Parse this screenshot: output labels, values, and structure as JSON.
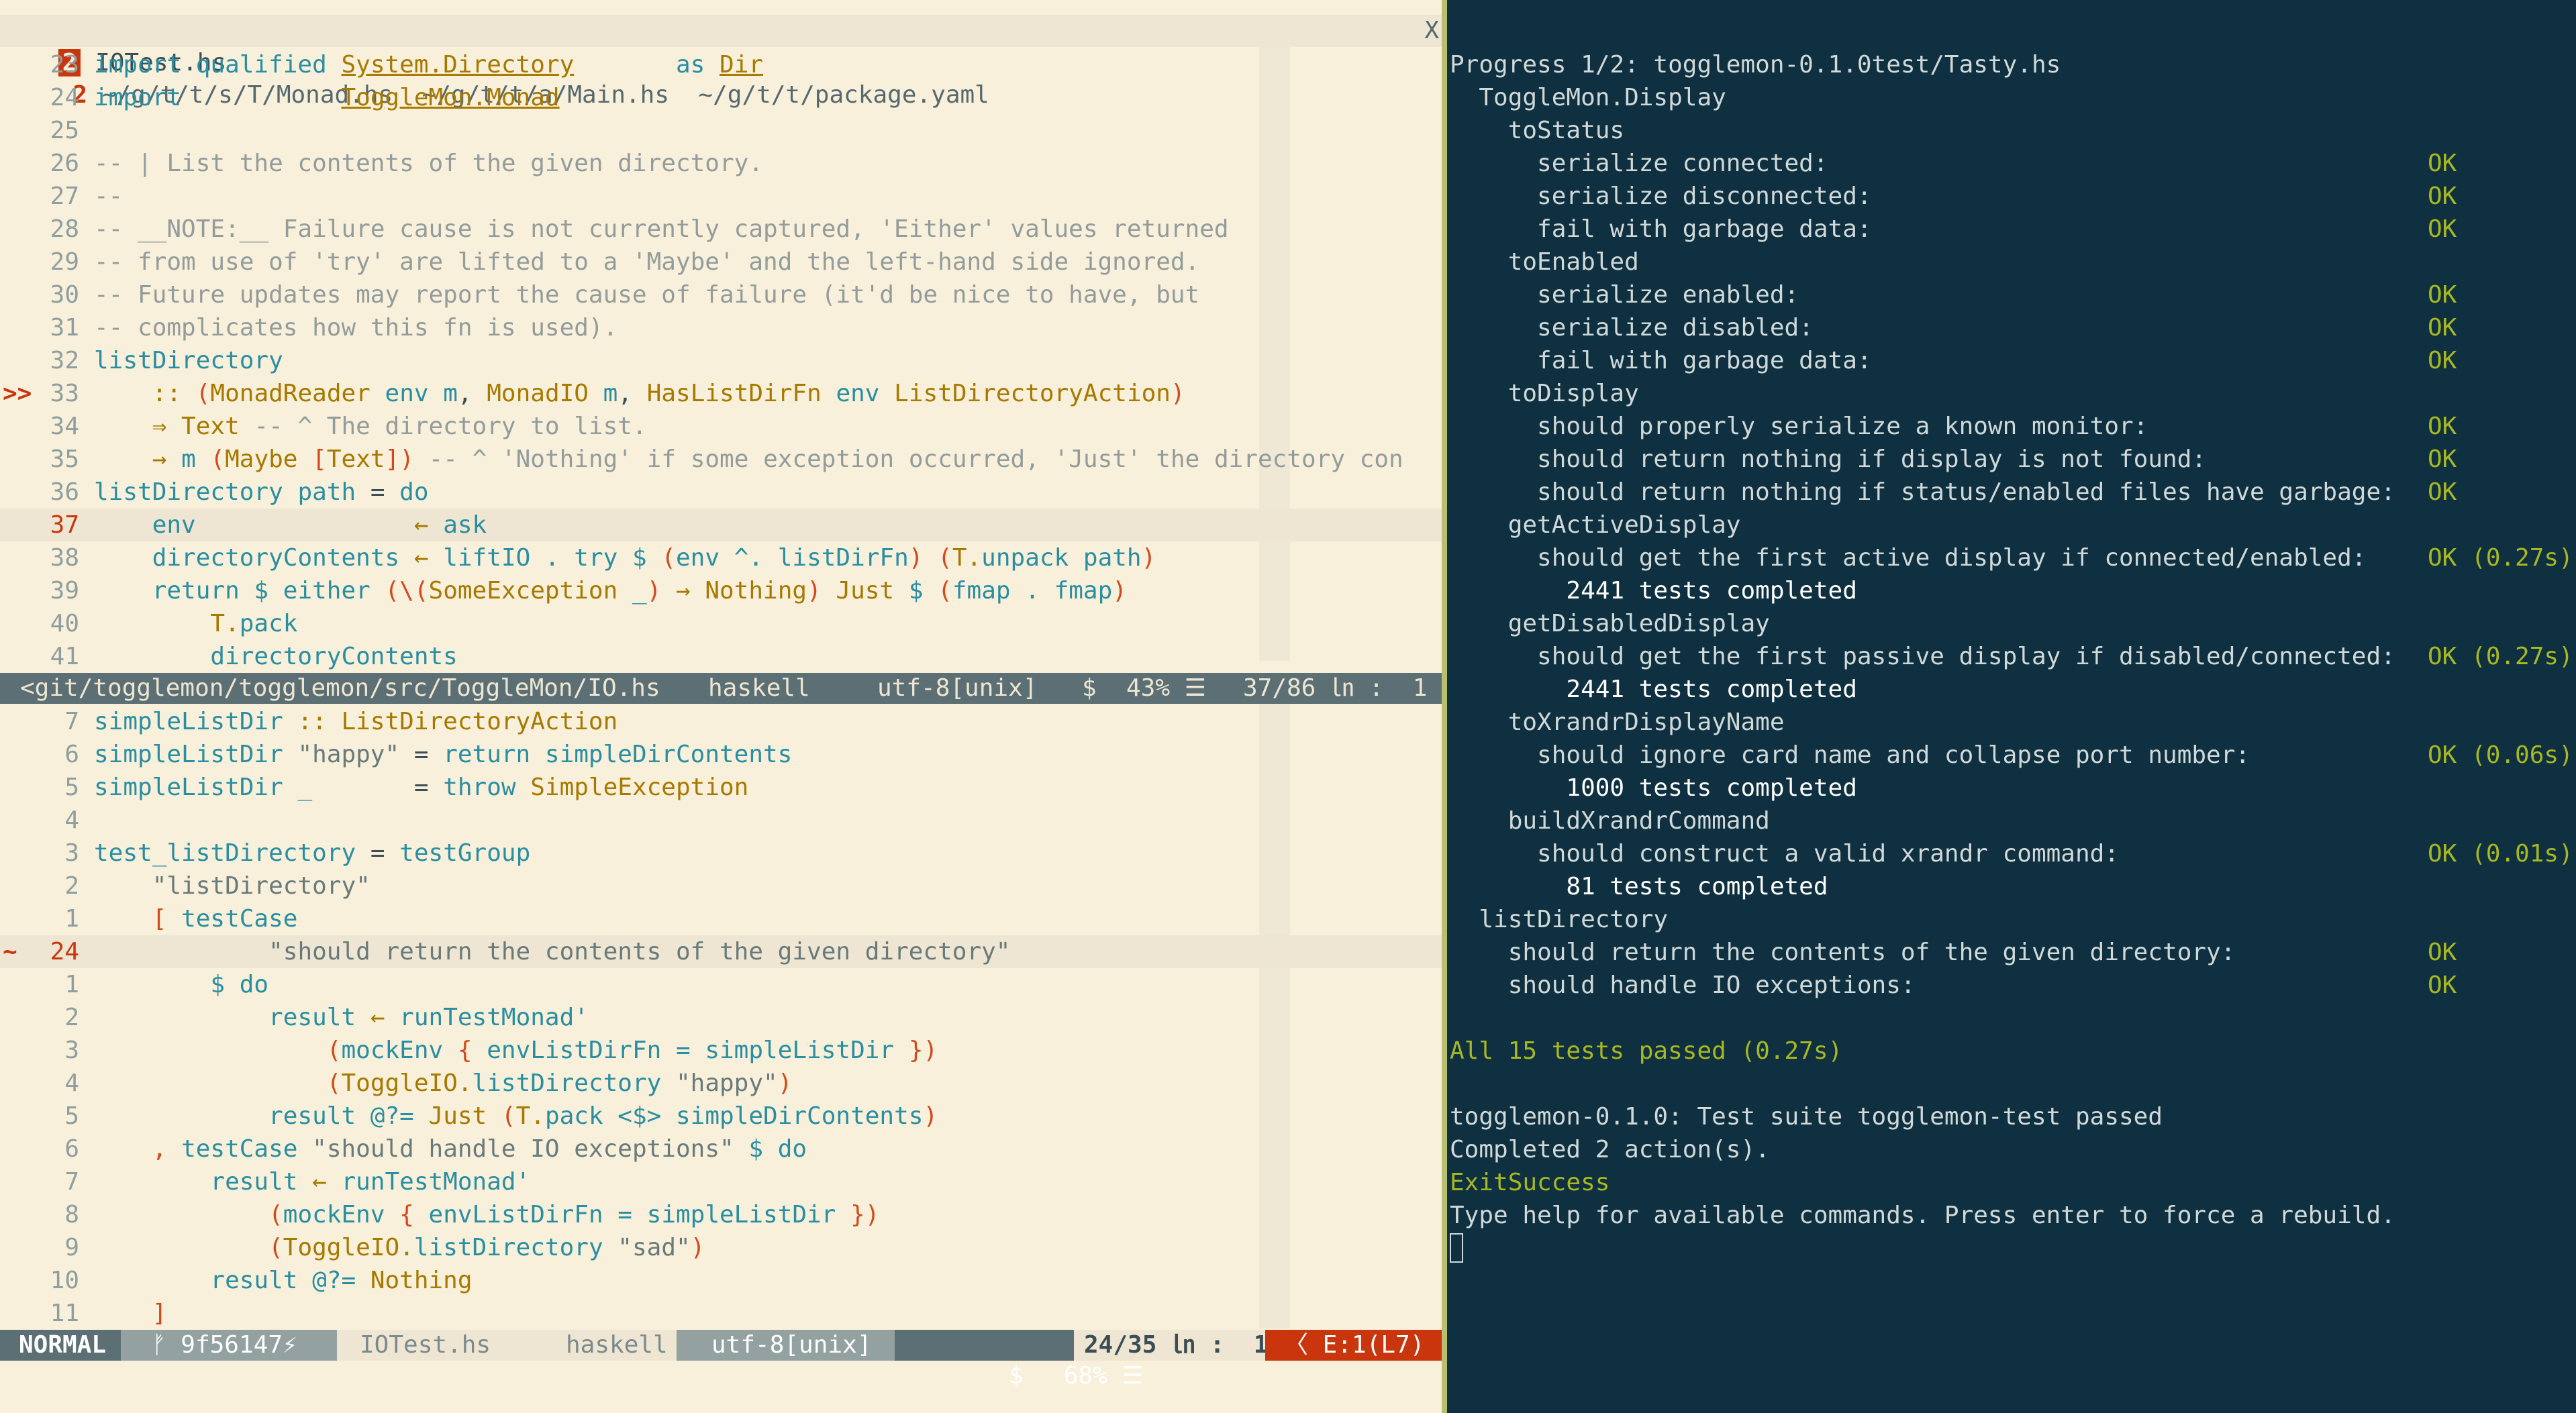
{
  "tabline": {
    "tab1_num": "2",
    "tab1_label": "IOTest.hs",
    "tab2_num": "2",
    "tab2_label": " ~/g/t/t/s/T/Monad.hs  ~/g/t/t/a/Main.hs  ~/g/t/t/package.yaml",
    "close": "X"
  },
  "top_pane": {
    "lines": [
      {
        "n": "23",
        "parts": [
          [
            "kw",
            "import qualified "
          ],
          [
            "ty ul",
            "System.Directory"
          ],
          [
            "plain",
            "       "
          ],
          [
            "kw",
            "as "
          ],
          [
            "ty ul",
            "Dir"
          ]
        ]
      },
      {
        "n": "24",
        "parts": [
          [
            "kw",
            "import           "
          ],
          [
            "ty ul",
            "ToggleMon.Monad"
          ]
        ]
      },
      {
        "n": "25",
        "parts": []
      },
      {
        "n": "26",
        "parts": [
          [
            "cm",
            "-- | List the contents of the given directory."
          ]
        ]
      },
      {
        "n": "27",
        "parts": [
          [
            "cm",
            "--"
          ]
        ]
      },
      {
        "n": "28",
        "parts": [
          [
            "cm",
            "-- __NOTE:__ Failure cause is not currently captured, 'Either' values returned"
          ]
        ]
      },
      {
        "n": "29",
        "parts": [
          [
            "cm",
            "-- from use of 'try' are lifted to a 'Maybe' and the left-hand side ignored."
          ]
        ]
      },
      {
        "n": "30",
        "parts": [
          [
            "cm",
            "-- Future updates may report the cause of failure (it'd be nice to have, but"
          ]
        ]
      },
      {
        "n": "31",
        "parts": [
          [
            "cm",
            "-- complicates how this fn is used)."
          ]
        ]
      },
      {
        "n": "32",
        "parts": [
          [
            "fn",
            "listDirectory"
          ]
        ]
      },
      {
        "n": "33",
        "sign": ">>",
        "parts": [
          [
            "plain",
            "    "
          ],
          [
            "ty",
            ":: "
          ],
          [
            "op",
            "("
          ],
          [
            "ty",
            "MonadReader "
          ],
          [
            "pl",
            "env m"
          ],
          [
            "plain",
            ", "
          ],
          [
            "ty",
            "MonadIO "
          ],
          [
            "pl",
            "m"
          ],
          [
            "plain",
            ", "
          ],
          [
            "ty",
            "HasListDirFn "
          ],
          [
            "pl",
            "env "
          ],
          [
            "ty",
            "ListDirectoryAction"
          ],
          [
            "op",
            ")"
          ]
        ]
      },
      {
        "n": "34",
        "parts": [
          [
            "plain",
            "    "
          ],
          [
            "ty",
            "⇒ Text "
          ],
          [
            "cm",
            "-- ^ The directory to list."
          ]
        ]
      },
      {
        "n": "35",
        "parts": [
          [
            "plain",
            "    "
          ],
          [
            "ty",
            "→ "
          ],
          [
            "pl",
            "m "
          ],
          [
            "op",
            "("
          ],
          [
            "ty",
            "Maybe "
          ],
          [
            "op",
            "["
          ],
          [
            "ty",
            "Text"
          ],
          [
            "op",
            "]) "
          ],
          [
            "cm",
            "-- ^ 'Nothing' if some exception occurred, 'Just' the directory con"
          ]
        ]
      },
      {
        "n": "36",
        "parts": [
          [
            "fn",
            "listDirectory "
          ],
          [
            "pl",
            "path "
          ],
          [
            "plain",
            "= "
          ],
          [
            "kw",
            "do"
          ]
        ]
      },
      {
        "n": "37",
        "cur": true,
        "parts": [
          [
            "plain",
            "    "
          ],
          [
            "pl",
            "env"
          ],
          [
            "plain",
            "               "
          ],
          [
            "ty",
            "← "
          ],
          [
            "pl",
            "ask"
          ]
        ]
      },
      {
        "n": "38",
        "parts": [
          [
            "plain",
            "    "
          ],
          [
            "pl",
            "directoryContents "
          ],
          [
            "ty",
            "← "
          ],
          [
            "pl",
            "liftIO . try $ "
          ],
          [
            "op",
            "("
          ],
          [
            "pl",
            "env ^. listDirFn"
          ],
          [
            "op",
            ") ("
          ],
          [
            "ty",
            "T."
          ],
          [
            "pl",
            "unpack path"
          ],
          [
            "op",
            ")"
          ]
        ]
      },
      {
        "n": "39",
        "parts": [
          [
            "plain",
            "    "
          ],
          [
            "pl",
            "return $ either "
          ],
          [
            "op",
            "(\\("
          ],
          [
            "ty",
            "SomeException "
          ],
          [
            "pl",
            "_"
          ],
          [
            "op",
            ") "
          ],
          [
            "ty",
            "→ Nothing"
          ],
          [
            "op",
            ") "
          ],
          [
            "ty",
            "Just "
          ],
          [
            "pl",
            "$ "
          ],
          [
            "op",
            "("
          ],
          [
            "pl",
            "fmap . fmap"
          ],
          [
            "op",
            ")"
          ]
        ]
      },
      {
        "n": "40",
        "parts": [
          [
            "plain",
            "        "
          ],
          [
            "ty",
            "T."
          ],
          [
            "pl",
            "pack"
          ]
        ]
      },
      {
        "n": "41",
        "parts": [
          [
            "plain",
            "        "
          ],
          [
            "pl",
            "directoryContents"
          ]
        ]
      }
    ]
  },
  "status1": {
    "path": "<git/togglemon/togglemon/src/ToggleMon/IO.hs",
    "filetype": "haskell",
    "encoding": "utf-8[unix]",
    "dollar": "$",
    "percent": "43% ☰",
    "position": "37/86 ㏑ :  1"
  },
  "bottom_pane": {
    "lines": [
      {
        "n": "7",
        "parts": [
          [
            "fn",
            "simpleListDir "
          ],
          [
            "ty",
            ":: ListDirectoryAction"
          ]
        ]
      },
      {
        "n": "6",
        "parts": [
          [
            "fn",
            "simpleListDir "
          ],
          [
            "st",
            "\"happy\" "
          ],
          [
            "plain",
            "= "
          ],
          [
            "pl",
            "return simpleDirContents"
          ]
        ]
      },
      {
        "n": "5",
        "parts": [
          [
            "fn",
            "simpleListDir "
          ],
          [
            "pl",
            "_       "
          ],
          [
            "plain",
            "= "
          ],
          [
            "pl",
            "throw "
          ],
          [
            "ty",
            "SimpleException"
          ]
        ]
      },
      {
        "n": "4",
        "parts": []
      },
      {
        "n": "3",
        "parts": [
          [
            "fn",
            "test_listDirectory "
          ],
          [
            "plain",
            "= "
          ],
          [
            "pl",
            "testGroup"
          ]
        ]
      },
      {
        "n": "2",
        "parts": [
          [
            "plain",
            "    "
          ],
          [
            "st",
            "\"listDirectory\""
          ]
        ]
      },
      {
        "n": "1",
        "parts": [
          [
            "plain",
            "    "
          ],
          [
            "op",
            "[ "
          ],
          [
            "pl",
            "testCase"
          ]
        ]
      },
      {
        "n": "24",
        "sign": "~",
        "cur": true,
        "parts": [
          [
            "plain",
            "            "
          ],
          [
            "st",
            "\"should return the contents of the given directory\""
          ]
        ]
      },
      {
        "n": "1",
        "parts": [
          [
            "plain",
            "        "
          ],
          [
            "pl",
            "$ "
          ],
          [
            "kw",
            "do"
          ]
        ]
      },
      {
        "n": "2",
        "parts": [
          [
            "plain",
            "            "
          ],
          [
            "pl",
            "result "
          ],
          [
            "ty",
            "← "
          ],
          [
            "pl",
            "runTestMonad'"
          ]
        ]
      },
      {
        "n": "3",
        "parts": [
          [
            "plain",
            "                "
          ],
          [
            "op",
            "("
          ],
          [
            "pl",
            "mockEnv "
          ],
          [
            "op",
            "{ "
          ],
          [
            "pl",
            "envListDirFn = simpleListDir "
          ],
          [
            "op",
            "})"
          ]
        ]
      },
      {
        "n": "4",
        "parts": [
          [
            "plain",
            "                "
          ],
          [
            "op",
            "("
          ],
          [
            "ty",
            "ToggleIO."
          ],
          [
            "pl",
            "listDirectory "
          ],
          [
            "st",
            "\"happy\""
          ],
          [
            "op",
            ")"
          ]
        ]
      },
      {
        "n": "5",
        "parts": [
          [
            "plain",
            "            "
          ],
          [
            "pl",
            "result @?= "
          ],
          [
            "ty",
            "Just "
          ],
          [
            "op",
            "("
          ],
          [
            "ty",
            "T."
          ],
          [
            "pl",
            "pack <$> simpleDirContents"
          ],
          [
            "op",
            ")"
          ]
        ]
      },
      {
        "n": "6",
        "parts": [
          [
            "plain",
            "    "
          ],
          [
            "op",
            ", "
          ],
          [
            "pl",
            "testCase "
          ],
          [
            "st",
            "\"should handle IO exceptions\" "
          ],
          [
            "pl",
            "$ "
          ],
          [
            "kw",
            "do"
          ]
        ]
      },
      {
        "n": "7",
        "parts": [
          [
            "plain",
            "        "
          ],
          [
            "pl",
            "result "
          ],
          [
            "ty",
            "← "
          ],
          [
            "pl",
            "runTestMonad'"
          ]
        ]
      },
      {
        "n": "8",
        "parts": [
          [
            "plain",
            "            "
          ],
          [
            "op",
            "("
          ],
          [
            "pl",
            "mockEnv "
          ],
          [
            "op",
            "{ "
          ],
          [
            "pl",
            "envListDirFn = simpleListDir "
          ],
          [
            "op",
            "})"
          ]
        ]
      },
      {
        "n": "9",
        "parts": [
          [
            "plain",
            "            "
          ],
          [
            "op",
            "("
          ],
          [
            "ty",
            "ToggleIO."
          ],
          [
            "pl",
            "listDirectory "
          ],
          [
            "st",
            "\"sad\""
          ],
          [
            "op",
            ")"
          ]
        ]
      },
      {
        "n": "10",
        "parts": [
          [
            "plain",
            "        "
          ],
          [
            "pl",
            "result @?= "
          ],
          [
            "ty",
            "Nothing"
          ]
        ]
      },
      {
        "n": "11",
        "parts": [
          [
            "plain",
            "    "
          ],
          [
            "op",
            "]"
          ]
        ]
      }
    ]
  },
  "status2": {
    "mode": "NORMAL",
    "branch": "ᚠ 9f56147⚡",
    "file": "IOTest.hs",
    "filetype": "haskell",
    "encoding": "utf-8[unix]",
    "dollar": "$",
    "percent": "68% ☰",
    "position": "24/35 ㏑ :  1",
    "error": "〈 E:1(L7)"
  },
  "terminal": {
    "lines": [
      {
        "indent": "",
        "text": "Progress 1/2: togglemon-0.1.0test/Tasty.hs",
        "ok": ""
      },
      {
        "indent": "  ",
        "text": "ToggleMon.Display",
        "ok": ""
      },
      {
        "indent": "    ",
        "text": "toStatus",
        "ok": ""
      },
      {
        "indent": "      ",
        "text": "serialize connected:",
        "ok": "OK"
      },
      {
        "indent": "      ",
        "text": "serialize disconnected:",
        "ok": "OK"
      },
      {
        "indent": "      ",
        "text": "fail with garbage data:",
        "ok": "OK"
      },
      {
        "indent": "    ",
        "text": "toEnabled",
        "ok": ""
      },
      {
        "indent": "      ",
        "text": "serialize enabled:",
        "ok": "OK"
      },
      {
        "indent": "      ",
        "text": "serialize disabled:",
        "ok": "OK"
      },
      {
        "indent": "      ",
        "text": "fail with garbage data:",
        "ok": "OK"
      },
      {
        "indent": "    ",
        "text": "toDisplay",
        "ok": ""
      },
      {
        "indent": "      ",
        "text": "should properly serialize a known monitor:",
        "ok": "OK"
      },
      {
        "indent": "      ",
        "text": "should return nothing if display is not found:",
        "ok": "OK"
      },
      {
        "indent": "      ",
        "text": "should return nothing if status/enabled files have garbage:",
        "ok": "OK"
      },
      {
        "indent": "    ",
        "text": "getActiveDisplay",
        "ok": ""
      },
      {
        "indent": "      ",
        "text": "should get the first active display if connected/enabled:",
        "ok": "OK (0.27s)"
      },
      {
        "indent": "        ",
        "text": "2441 tests completed",
        "ok": "",
        "white": true
      },
      {
        "indent": "    ",
        "text": "getDisabledDisplay",
        "ok": ""
      },
      {
        "indent": "      ",
        "text": "should get the first passive display if disabled/connected:",
        "ok": "OK (0.27s)"
      },
      {
        "indent": "        ",
        "text": "2441 tests completed",
        "ok": "",
        "white": true
      },
      {
        "indent": "    ",
        "text": "toXrandrDisplayName",
        "ok": ""
      },
      {
        "indent": "      ",
        "text": "should ignore card name and collapse port number:",
        "ok": "OK (0.06s)"
      },
      {
        "indent": "        ",
        "text": "1000 tests completed",
        "ok": "",
        "white": true
      },
      {
        "indent": "    ",
        "text": "buildXrandrCommand",
        "ok": ""
      },
      {
        "indent": "      ",
        "text": "should construct a valid xrandr command:",
        "ok": "OK (0.01s)"
      },
      {
        "indent": "        ",
        "text": "81 tests completed",
        "ok": "",
        "white": true
      },
      {
        "indent": "  ",
        "text": "listDirectory",
        "ok": ""
      },
      {
        "indent": "    ",
        "text": "should return the contents of the given directory:",
        "ok": "OK"
      },
      {
        "indent": "    ",
        "text": "should handle IO exceptions:",
        "ok": "OK"
      },
      {
        "indent": "",
        "text": "",
        "ok": ""
      },
      {
        "indent": "",
        "text": "",
        "ok": "",
        "greenline": "All 15 tests passed (0.27s)"
      },
      {
        "indent": "",
        "text": "",
        "ok": ""
      },
      {
        "indent": "",
        "text": "togglemon-0.1.0: Test suite togglemon-test passed",
        "ok": ""
      },
      {
        "indent": "",
        "text": "Completed 2 action(s).",
        "ok": ""
      },
      {
        "indent": "",
        "text": "",
        "ok": "",
        "greenline": "ExitSuccess"
      },
      {
        "indent": "",
        "text": "Type help for available commands. Press enter to force a rebuild.",
        "ok": ""
      }
    ]
  },
  "colors": {
    "vim_bg": "#f8f0da",
    "term_bg": "#0f3040",
    "ok_green": "#a8b820",
    "error_orange": "#c9360d"
  }
}
